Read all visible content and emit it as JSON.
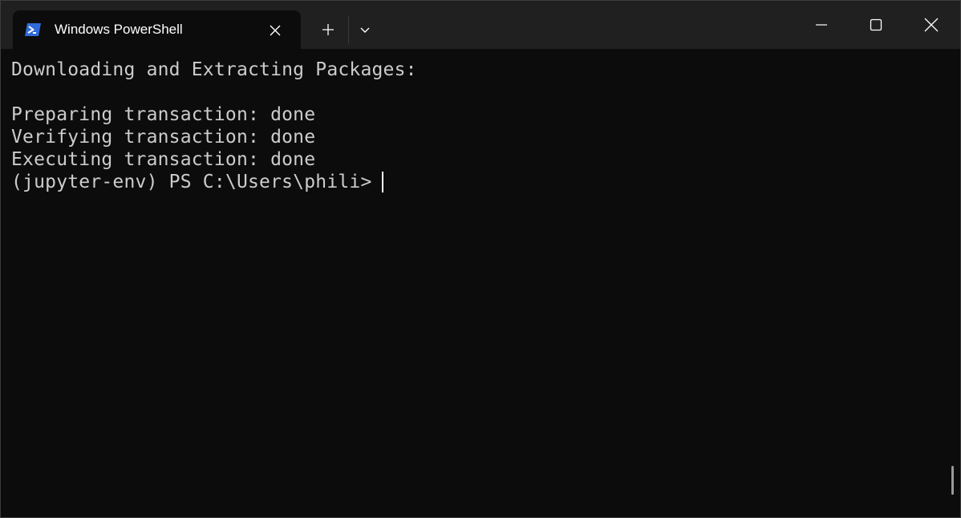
{
  "window": {
    "tab_title": "Windows PowerShell",
    "tab_icon": "powershell-icon",
    "new_tab_icon": "plus-icon",
    "dropdown_icon": "chevron-down-icon",
    "minimize_icon": "minimize-icon",
    "maximize_icon": "maximize-icon",
    "close_icon": "close-icon"
  },
  "terminal": {
    "lines": [
      "Downloading and Extracting Packages:",
      "",
      "Preparing transaction: done",
      "Verifying transaction: done",
      "Executing transaction: done"
    ],
    "prompt": "(jupyter-env) PS C:\\Users\\phili> "
  },
  "colors": {
    "background": "#0c0c0c",
    "titlebar": "#202020",
    "text": "#cccccc",
    "powershell_accent": "#2f6bd8"
  }
}
